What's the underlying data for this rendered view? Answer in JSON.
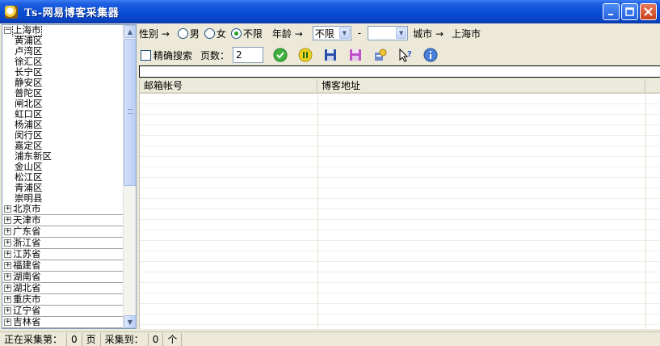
{
  "window": {
    "title": "Ts-网易博客采集器"
  },
  "tree": {
    "expanded_root": "上海市",
    "children": [
      "黄浦区",
      "卢湾区",
      "徐汇区",
      "长宁区",
      "静安区",
      "普陀区",
      "闸北区",
      "虹口区",
      "杨浦区",
      "闵行区",
      "嘉定区",
      "浦东新区",
      "金山区",
      "松江区",
      "青浦区",
      "崇明县"
    ],
    "provinces": [
      "北京市",
      "天津市",
      "广东省",
      "浙江省",
      "江苏省",
      "福建省",
      "湖南省",
      "湖北省",
      "重庆市",
      "辽宁省",
      "吉林省"
    ]
  },
  "filters": {
    "gender_label": "性别 →",
    "gender_options": [
      "男",
      "女",
      "不限"
    ],
    "gender_selected": "不限",
    "age_label": "年龄 →",
    "age_from": "不限",
    "age_sep": "-",
    "age_to": "",
    "city_label": "城市 →",
    "city_value": "上海市"
  },
  "toolbar": {
    "exact_search_label": "精确搜索",
    "pages_label": "页数：",
    "pages_value": "2"
  },
  "grid": {
    "columns": [
      "邮箱帐号",
      "博客地址"
    ]
  },
  "status": {
    "collecting_label": "正在采集第：",
    "page_count": "0",
    "page_unit": "页",
    "collected_label": "采集到：",
    "collected_count": "0",
    "item_unit": "个"
  }
}
